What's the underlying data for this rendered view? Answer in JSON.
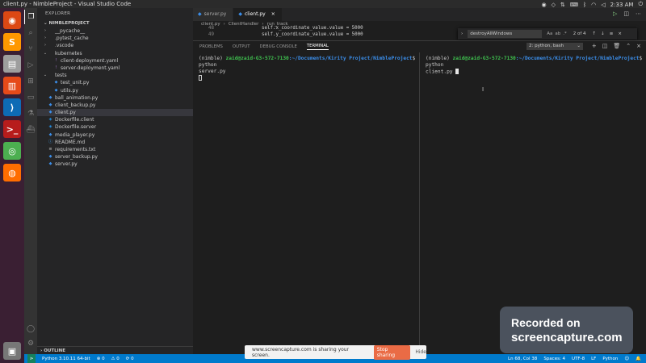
{
  "topbar": {
    "title": "client.py - NimbleProject - Visual Studio Code",
    "time": "2:33 AM"
  },
  "dock": {
    "apps": [
      {
        "name": "ubuntu-logo-icon",
        "color": "#dd4814",
        "glyph": "◉"
      },
      {
        "name": "sublime-text-icon",
        "color": "#ff9800",
        "glyph": "S"
      },
      {
        "name": "files-icon",
        "color": "#9e9e9e",
        "glyph": "▤"
      },
      {
        "name": "impress-icon",
        "color": "#e64a19",
        "glyph": "▥"
      },
      {
        "name": "vscode-icon",
        "color": "#0e6bb5",
        "glyph": "⟩"
      },
      {
        "name": "terminal-icon",
        "color": "#b71c1c",
        "glyph": ">_"
      },
      {
        "name": "chrome-icon",
        "color": "#4caf50",
        "glyph": "◎"
      },
      {
        "name": "firefox-icon",
        "color": "#ff6d00",
        "glyph": "◍"
      }
    ],
    "trash": {
      "name": "trash-icon",
      "color": "#777777",
      "glyph": "▣"
    }
  },
  "sidebar": {
    "header": "EXPLORER",
    "project": "NIMBLEPROJECT",
    "items": [
      {
        "label": "__pycache__",
        "indent": 1,
        "twisty": "›",
        "icon": "",
        "active": false
      },
      {
        "label": ".pytest_cache",
        "indent": 1,
        "twisty": "›",
        "icon": "",
        "active": false
      },
      {
        "label": ".vscode",
        "indent": 1,
        "twisty": "›",
        "icon": "",
        "active": false
      },
      {
        "label": "kubernetes",
        "indent": 1,
        "twisty": "⌄",
        "icon": "",
        "active": false
      },
      {
        "label": "client-deployment.yaml",
        "indent": 2,
        "twisty": "",
        "icon": "!",
        "active": false
      },
      {
        "label": "server-deployment.yaml",
        "indent": 2,
        "twisty": "",
        "icon": "!",
        "active": false
      },
      {
        "label": "tests",
        "indent": 1,
        "twisty": "⌄",
        "icon": "",
        "active": false
      },
      {
        "label": "test_unit.py",
        "indent": 2,
        "twisty": "",
        "icon": "◆",
        "active": false
      },
      {
        "label": "utils.py",
        "indent": 2,
        "twisty": "",
        "icon": "◆",
        "active": false
      },
      {
        "label": "ball_animation.py",
        "indent": 1,
        "twisty": "",
        "icon": "◆",
        "active": false
      },
      {
        "label": "client_backup.py",
        "indent": 1,
        "twisty": "",
        "icon": "◆",
        "active": false
      },
      {
        "label": "client.py",
        "indent": 1,
        "twisty": "",
        "icon": "◆",
        "active": true
      },
      {
        "label": "Dockerfile.client",
        "indent": 1,
        "twisty": "",
        "icon": "◈",
        "active": false
      },
      {
        "label": "Dockerfile.server",
        "indent": 1,
        "twisty": "",
        "icon": "◈",
        "active": false
      },
      {
        "label": "media_player.py",
        "indent": 1,
        "twisty": "",
        "icon": "◆",
        "active": false
      },
      {
        "label": "README.md",
        "indent": 1,
        "twisty": "",
        "icon": "ⓘ",
        "active": false
      },
      {
        "label": "requirements.txt",
        "indent": 1,
        "twisty": "",
        "icon": "≡",
        "active": false
      },
      {
        "label": "server_backup.py",
        "indent": 1,
        "twisty": "",
        "icon": "◆",
        "active": false
      },
      {
        "label": "server.py",
        "indent": 1,
        "twisty": "",
        "icon": "◆",
        "active": false
      }
    ],
    "outline": "OUTLINE"
  },
  "editor": {
    "tabs": [
      {
        "label": "server.py",
        "active": false
      },
      {
        "label": "client.py",
        "active": true
      }
    ],
    "breadcrumbs": [
      "client.py",
      "›",
      "ClientHandler",
      "›",
      "run_track"
    ],
    "code": [
      {
        "ln": "48",
        "text": "self.x_coordinate_value.value = 5000"
      },
      {
        "ln": "49",
        "text": "self.y_coordinate_value.value = 5000"
      }
    ],
    "find": {
      "value": "destroyAllWindows",
      "opts": [
        "Aa",
        "ab",
        ".*"
      ],
      "count": "2 of 4"
    }
  },
  "panel": {
    "tabs": [
      {
        "label": "PROBLEMS",
        "active": false
      },
      {
        "label": "OUTPUT",
        "active": false
      },
      {
        "label": "DEBUG CONSOLE",
        "active": false
      },
      {
        "label": "TERMINAL",
        "active": true
      }
    ],
    "terminal_select": "2: python, bash",
    "left": {
      "env": "(nimble)",
      "user": "zaid@zaid-G3-572-7130",
      "path": ":~/Documents/Kirity Project/NimbleProject",
      "cmd": "$ python",
      "cmd2": "server.py"
    },
    "right": {
      "env": "(nimble)",
      "user": "zaid@zaid-G3-572-7130",
      "path": ":~/Documents/Kirity Project/NimbleProject",
      "cmd": "$ python",
      "cmd2": "client.py"
    }
  },
  "status": {
    "python": "Python 3.10.11 64-bit",
    "errors": "⊗ 0",
    "warnings": "⚠ 0",
    "ports": "⟳ 0",
    "position": "Ln 68, Col 38",
    "spaces": "Spaces: 4",
    "encoding": "UTF-8",
    "eol": "LF",
    "language": "Python"
  },
  "share": {
    "message": "www.screencapture.com is sharing your screen.",
    "stop": "Stop sharing",
    "hide": "Hide"
  },
  "watermark": {
    "line1": "Recorded on",
    "line2": "screencapture.com"
  }
}
